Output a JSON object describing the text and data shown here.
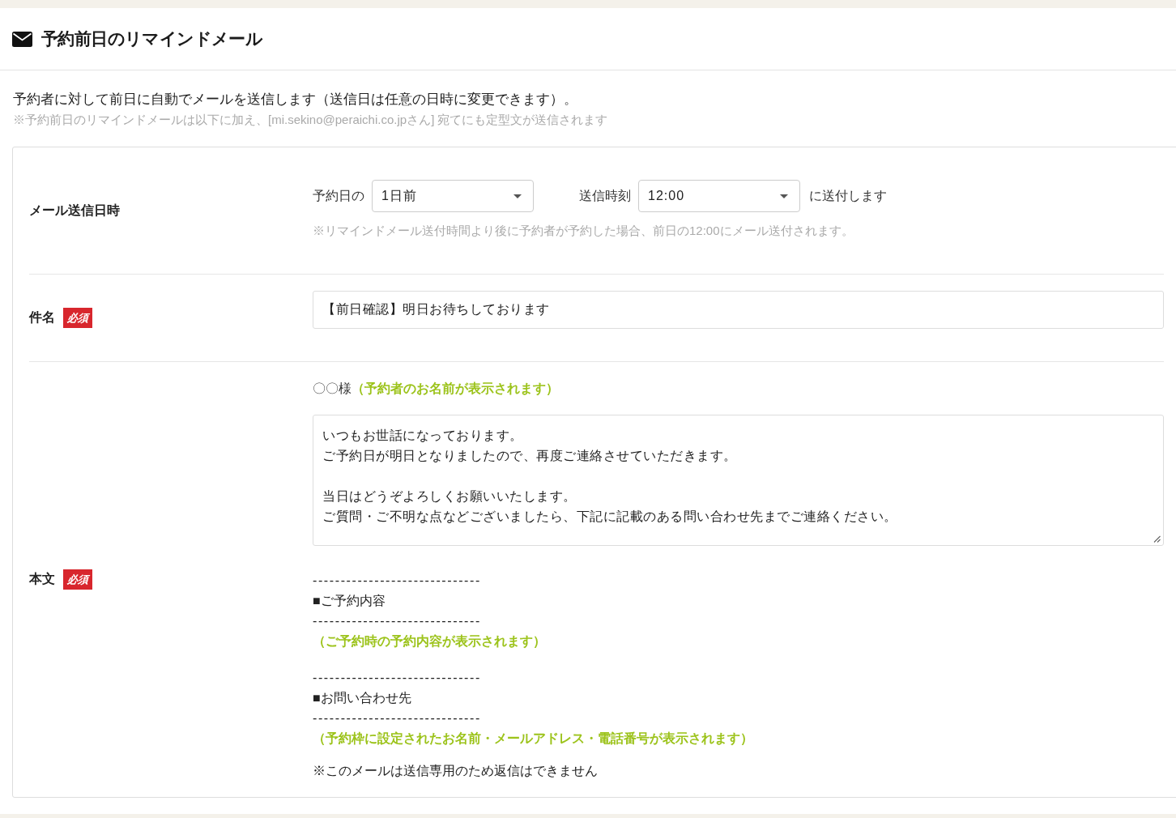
{
  "title": "予約前日のリマインドメール",
  "intro": {
    "description": "予約者に対して前日に自動でメールを送信します（送信日は任意の日時に変更できます）。",
    "note": "※予約前日のリマインドメールは以下に加え、[mi.sekino@peraichi.co.jpさん] 宛てにも定型文が送信されます"
  },
  "form": {
    "rows": [
      {
        "kind": "schedule",
        "label": "メール送信日時",
        "required": false,
        "day_prefix": "予約日の",
        "day_select": "1日前",
        "time_label": "送信時刻",
        "time_select": "12:00",
        "suffix": "に送付します",
        "note": "※リマインドメール送付時間より後に予約者が予約した場合、前日の12:00にメール送付されます。"
      },
      {
        "kind": "subject",
        "label": "件名",
        "required": true,
        "badge": "必須",
        "value": "【前日確認】明日お待ちしております"
      },
      {
        "kind": "body",
        "label": "本文",
        "required": true,
        "badge": "必須",
        "greeting": "〇〇様",
        "greeting_hint": "（予約者のお名前が表示されます）",
        "paragraphs": [
          {
            "lines": [
              "いつもお世話になっております。",
              "ご予約日が明日となりましたので、再度ご連絡させていただきます。"
            ]
          },
          {
            "lines": [
              "当日はどうぞよろしくお願いいたします。",
              "ご質問・ご不明な点などございましたら、下記に記載のある問い合わせ先までご連絡ください。"
            ]
          }
        ],
        "sections": [
          {
            "lines": [
              {
                "kind": "rule",
                "text": "------------------------------"
              },
              {
                "kind": "heading",
                "text": "■ご予約内容"
              },
              {
                "kind": "rule",
                "text": "------------------------------"
              },
              {
                "kind": "hint",
                "text": "（ご予約時の予約内容が表示されます）"
              }
            ]
          },
          {
            "lines": [
              {
                "kind": "rule",
                "text": "------------------------------"
              },
              {
                "kind": "heading",
                "text": "■お問い合わせ先"
              },
              {
                "kind": "rule",
                "text": "------------------------------"
              },
              {
                "kind": "hint",
                "text": "（予約枠に設定されたお名前・メールアドレス・電話番号が表示されます）"
              }
            ]
          }
        ],
        "closing": "※このメールは送信専用のため返信はできません"
      }
    ]
  }
}
